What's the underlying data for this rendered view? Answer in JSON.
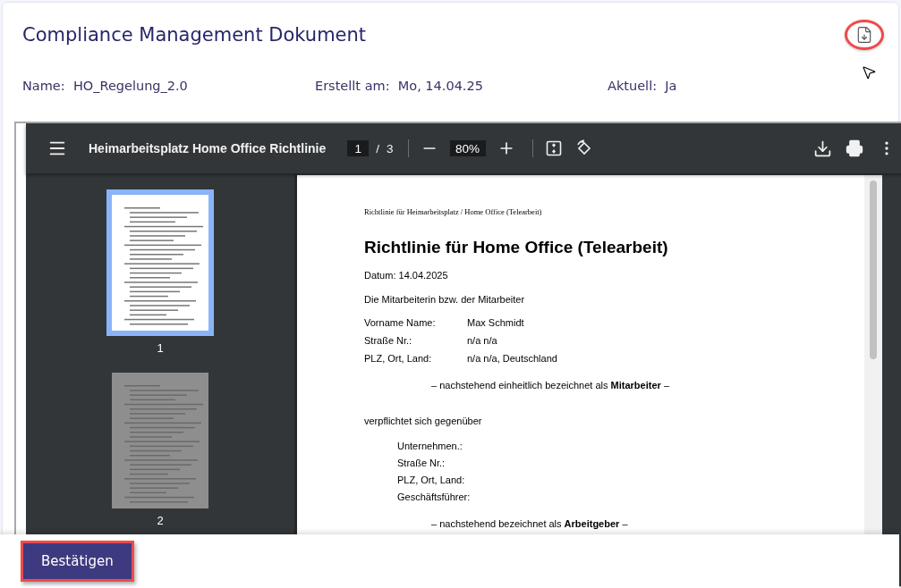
{
  "header": {
    "title": "Compliance Management Dokument"
  },
  "meta": [
    {
      "label": "Name:",
      "value": "HO_Regelung_2.0"
    },
    {
      "label": "Erstellt am:",
      "value": "Mo, 14.04.25"
    },
    {
      "label": "Aktuell:",
      "value": "Ja"
    }
  ],
  "viewer": {
    "title": "Heimarbeitsplatz Home Office Richtlinie",
    "page": "1",
    "separator": "/",
    "page_count": "3",
    "zoom": "80%",
    "thumbnails": [
      {
        "label": "1",
        "selected": true
      },
      {
        "label": "2",
        "selected": false
      }
    ],
    "document": {
      "running_header": "Richtlinie für Heimarbeitsplatz / Home Office (Telearbeit)",
      "heading": "Richtlinie für Home Office (Telearbeit)",
      "blocks": [
        {
          "kind": "para",
          "text": "Datum: 14.04.2025"
        },
        {
          "kind": "para",
          "text": "Die Mitarbeiterin bzw. der Mitarbeiter"
        },
        {
          "kind": "pairs",
          "rows": [
            {
              "label": "Vorname Name:",
              "value": "Max Schmidt"
            },
            {
              "label": "Straße Nr.:",
              "value": "n/a n/a"
            },
            {
              "label": "PLZ, Ort, Land:",
              "value": "n/a n/a, Deutschland"
            }
          ]
        },
        {
          "kind": "center",
          "text": "– nachstehend einheitlich bezeichnet als **Mitarbeiter** –"
        },
        {
          "kind": "para",
          "text": "verpflichtet sich gegenüber"
        },
        {
          "kind": "indented",
          "lines": [
            "Unternehmen.:",
            "Straße Nr.:",
            "PLZ, Ort, Land:",
            "Geschäftsführer:"
          ]
        },
        {
          "kind": "center",
          "text": "– nachstehend bezeichnet als **Arbeitgeber** –"
        }
      ]
    }
  },
  "footer": {
    "button": "Bestätigen"
  }
}
